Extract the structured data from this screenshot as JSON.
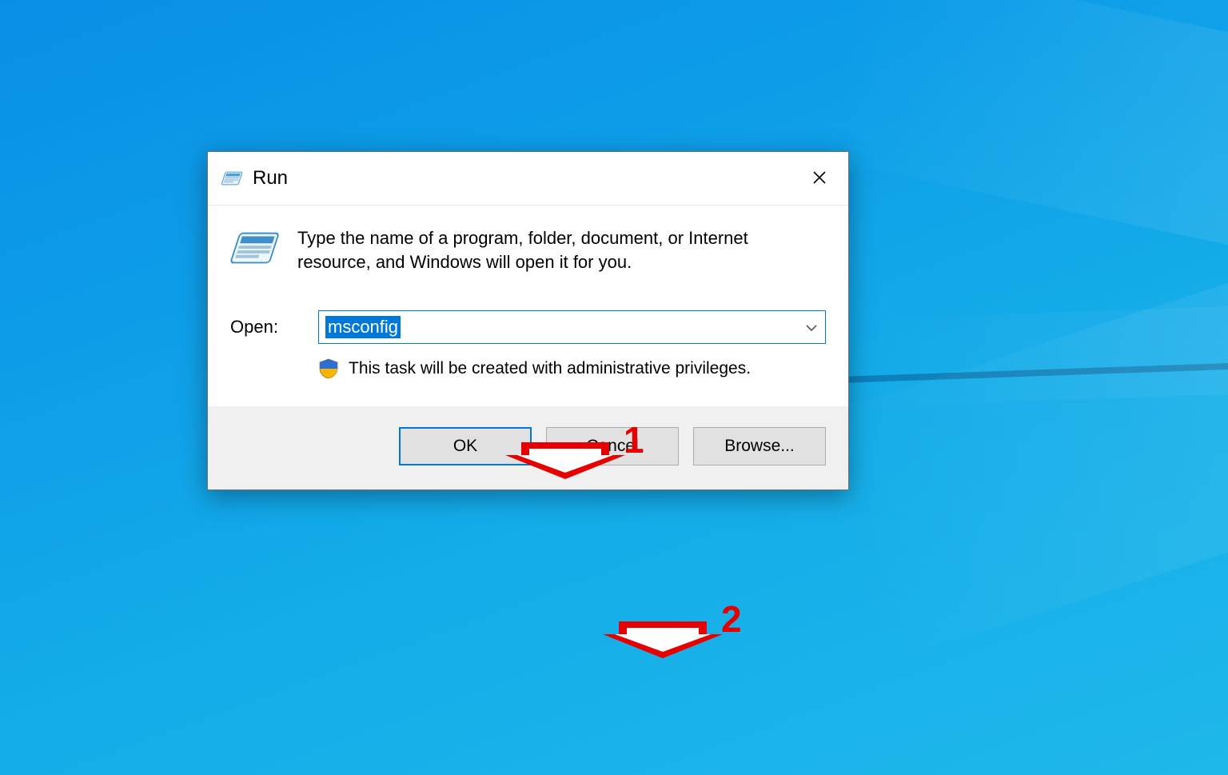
{
  "dialog": {
    "title": "Run",
    "description": "Type the name of a program, folder, document, or Internet resource, and Windows will open it for you.",
    "open_label": "Open:",
    "open_value": "msconfig",
    "admin_note": "This task will be created with administrative privileges.",
    "buttons": {
      "ok": "OK",
      "cancel": "Cancel",
      "browse": "Browse..."
    }
  },
  "annotations": {
    "step1": "1",
    "step2": "2"
  }
}
